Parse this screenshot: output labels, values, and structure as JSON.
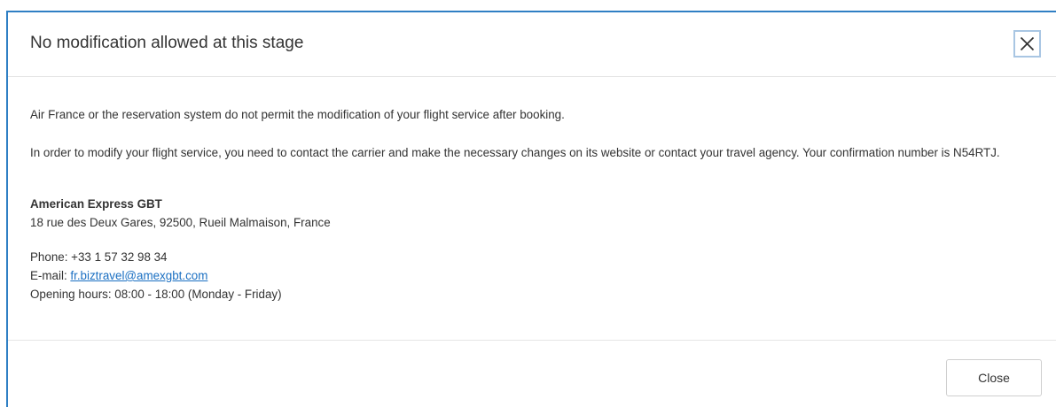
{
  "dialog": {
    "title": "No modification allowed at this stage",
    "close_icon": "close-icon",
    "body": {
      "message_1": "Air France or the reservation system do not permit the modification of your flight service after booking.",
      "message_2": "In order to modify your flight service, you need to contact the carrier and make the necessary changes on its website or contact your travel agency. Your confirmation number is N54RTJ.",
      "agency": {
        "name": "American Express GBT",
        "address": "18 rue des Deux Gares, 92500, Rueil Malmaison, France",
        "phone": "Phone: +33 1 57 32 98 34",
        "email_label": "E-mail: ",
        "email": "fr.biztravel@amexgbt.com",
        "opening_hours": "Opening hours: 08:00 - 18:00 (Monday - Friday)"
      }
    },
    "footer": {
      "close_label": "Close"
    }
  },
  "colors": {
    "accent_border": "#2f7fc4",
    "link": "#1a6fc2"
  }
}
